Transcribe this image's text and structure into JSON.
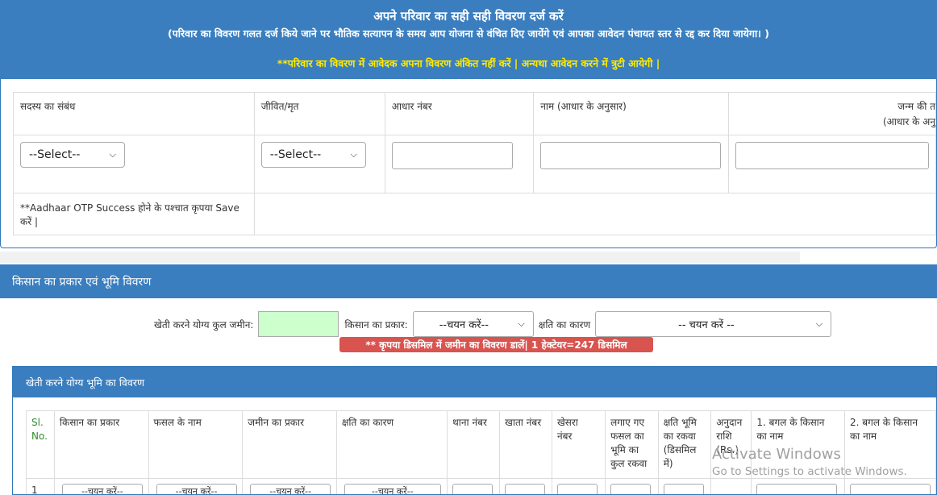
{
  "header": {
    "title": "अपने परिवार का सही सही विवरण दर्ज करें",
    "subtitle": "(परिवार का विवरण गलत दर्ज किये जाने पर भौतिक सत्यापन के समय आप योजना से वंचित दिए जायेंगे एवं आपका आवेदन पंचायत स्तर से रद्द कर दिया जायेगा। )",
    "warning": "**परिवार का विवरण में आवेदक अपना विवरण अंकित नहीं करें | अन्यथा आवेदन करने में त्रुटी आयेगी |"
  },
  "family": {
    "columns": [
      "सदस्य का संबंध",
      "जीवित/मृत",
      "आधार नंबर",
      "नाम (आधार के अनुसार)",
      "जन्म की त",
      "(आधार के अनु"
    ],
    "relation_select": "--Select--",
    "alive_select": "--Select--",
    "note": "**Aadhaar OTP Success होने के पश्चात कृपया Save करें |"
  },
  "land_section": {
    "title": "किसान का प्रकार एवं भूमि विवरण",
    "total_land_label": "खेती करने योग्य कुल जमीन:",
    "farmer_type_label": "किसान का प्रकार:",
    "farmer_type_select": "--चयन करें--",
    "damage_reason_label": "क्षति का कारण",
    "damage_reason_select": "-- चयन करें --",
    "note": "** कृपया डिसमिल में जमीन का विवरण डालें| 1 हेक्टेयर=247 डिसमिल"
  },
  "land_details": {
    "title": "खेती करने योग्य भूमि का विवरण",
    "columns": {
      "sl": "Sl.",
      "sl2": "No.",
      "farmer_type": "किसान का प्रकार",
      "crop_name": "फसल के नाम",
      "land_type": "जमीन का प्रकार",
      "damage_reason": "क्षति का कारण",
      "thana_no": "थाना नंबर",
      "khata_no": "खाता नंबर",
      "khesra": "खेसरा",
      "khesra2": "नंबर",
      "crop_area": "लगाए गए",
      "crop_area2": "फसल का",
      "crop_area3": "भूमि का",
      "crop_area4": "कुल रकवा",
      "damage_area": "क्षति भूमि",
      "damage_area2": "का रकवा",
      "damage_area3": "(डिसमिल",
      "damage_area4": "में)",
      "grant": "अनुदान",
      "grant2": "राशि",
      "grant3": "(Rs.)",
      "neighbor1": "1. बगल के किसान",
      "neighbor1b": "का नाम",
      "neighbor2": "2. बगल के किसान",
      "neighbor2b": "का नाम"
    },
    "row1_sl": "1",
    "row1_select": "--चयन करें--"
  },
  "watermark": {
    "line1": "Activate Windows",
    "line2": "Go to Settings to activate Windows."
  }
}
